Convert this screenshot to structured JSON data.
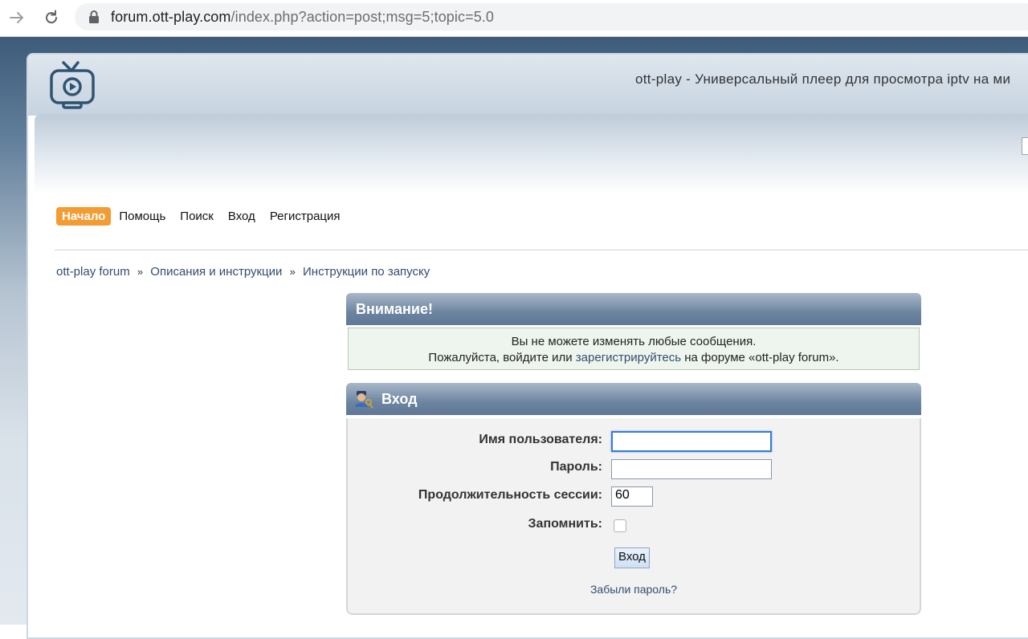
{
  "browser": {
    "url_domain": "forum.ott-play.com",
    "url_path": "/index.php?action=post;msg=5;topic=5.0"
  },
  "header": {
    "site_title": "ott-play - Универсальный плеер для просмотра iptv на ми"
  },
  "menu": {
    "items": [
      {
        "label": "Начало",
        "active": true
      },
      {
        "label": "Помощь"
      },
      {
        "label": "Поиск"
      },
      {
        "label": "Вход"
      },
      {
        "label": "Регистрация"
      }
    ]
  },
  "breadcrumb": {
    "items": [
      "ott-play forum",
      "Описания и инструкции",
      "Инструкции по запуску"
    ],
    "separator": "»"
  },
  "attention": {
    "title": "Внимание!",
    "line1": "Вы не можете изменять любые сообщения.",
    "line2_before": "Пожалуйста, войдите или ",
    "line2_link": "зарегистрируйтесь",
    "line2_after": " на форуме «ott-play forum»."
  },
  "login": {
    "title": "Вход",
    "username_label": "Имя пользователя:",
    "username_value": "",
    "password_label": "Пароль:",
    "password_value": "",
    "session_label": "Продолжительность сессии:",
    "session_value": "60",
    "remember_label": "Запомнить:",
    "remember_checked": false,
    "submit_label": "Вход",
    "forgot_label": "Забыли пароль?"
  },
  "colors": {
    "accent_orange": "#f39c33",
    "link_blue": "#334d6e",
    "bar_blue": "#6c84a0"
  }
}
